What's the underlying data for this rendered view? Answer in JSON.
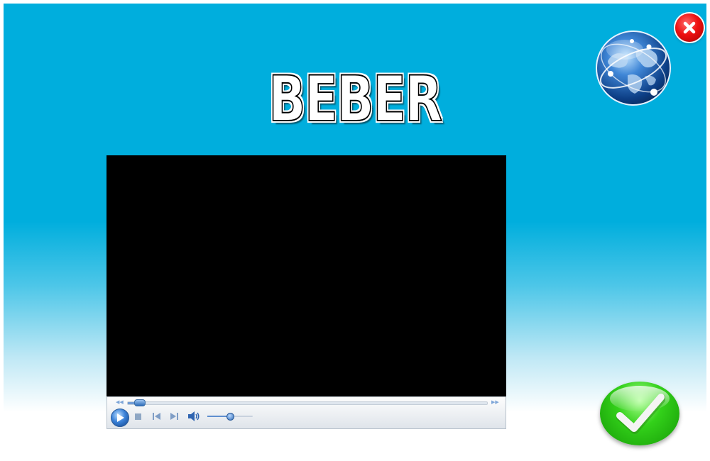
{
  "app": {
    "title": "BEBER"
  },
  "window_controls": {
    "close_icon": "close-x-icon",
    "close_color": "#e11111"
  },
  "globe": {
    "icon": "globe-network-icon"
  },
  "video_player": {
    "playback_progress": 0.02,
    "volume_level": 0.5,
    "controls": {
      "play_icon": "play-icon",
      "stop_icon": "stop-icon",
      "previous_icon": "previous-track-icon",
      "next_icon": "next-track-icon",
      "volume_icon": "speaker-volume-icon",
      "seek_back_icon": "rewind-icon",
      "seek_forward_icon": "fast-forward-icon"
    }
  },
  "confirm_button": {
    "icon": "checkmark-icon",
    "color": "#33d11a"
  },
  "colors": {
    "background_top": "#00aedd",
    "background_bottom": "#ffffff",
    "video_screen": "#000000"
  }
}
